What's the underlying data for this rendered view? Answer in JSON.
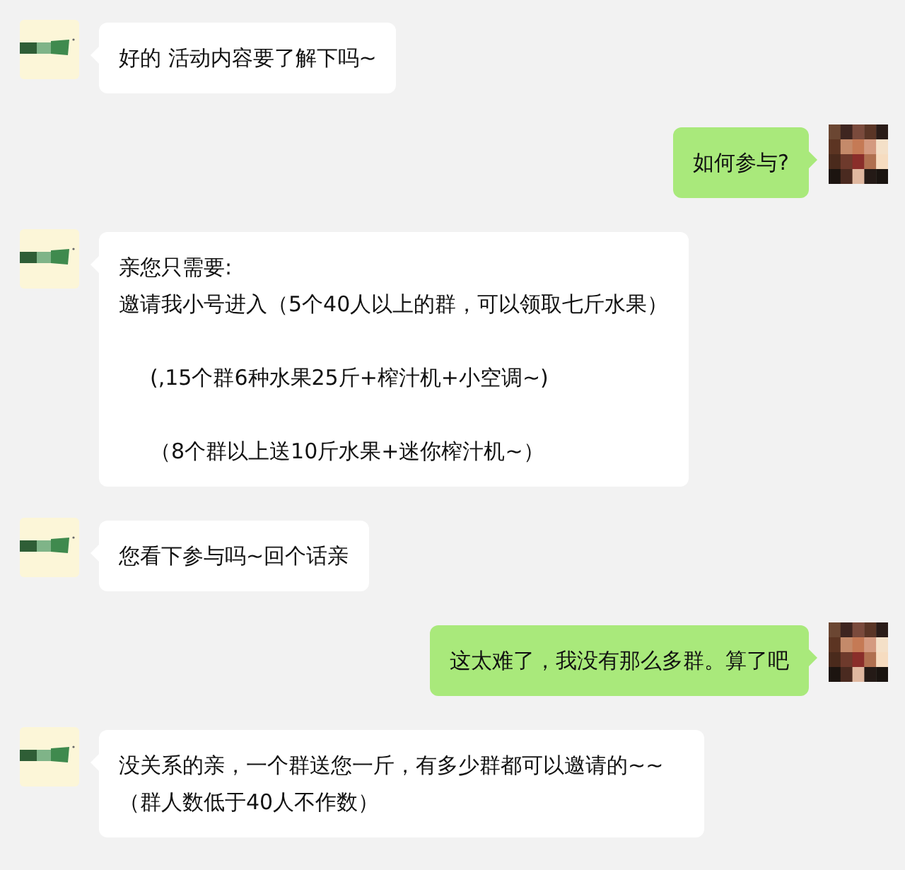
{
  "messages": [
    {
      "kind": "left",
      "paragraphs": [
        {
          "lines": [
            "好的  活动内容要了解下吗~"
          ]
        }
      ]
    },
    {
      "kind": "right",
      "paragraphs": [
        {
          "lines": [
            "如何参与?"
          ]
        }
      ]
    },
    {
      "kind": "left",
      "paragraphs": [
        {
          "lines": [
            "亲您只需要:",
            "邀请我小号进入（5个40人以上的群，可以领取七斤水果）"
          ]
        },
        {
          "lines": [
            "(,15个群6种水果25斤+榨汁机+小空调~)"
          ],
          "indent": true
        },
        {
          "lines": [
            "（8个群以上送10斤水果+迷你榨汁机~）"
          ],
          "indent": true
        }
      ]
    },
    {
      "kind": "left",
      "paragraphs": [
        {
          "lines": [
            "您看下参与吗~回个话亲"
          ]
        }
      ]
    },
    {
      "kind": "right",
      "paragraphs": [
        {
          "lines": [
            "这太难了，我没有那么多群。算了吧"
          ]
        }
      ]
    },
    {
      "kind": "left",
      "paragraphs": [
        {
          "lines": [
            "没关系的亲，一个群送您一斤，有多少群都可以邀请的~~（群人数低于40人不作数）"
          ]
        }
      ]
    }
  ]
}
